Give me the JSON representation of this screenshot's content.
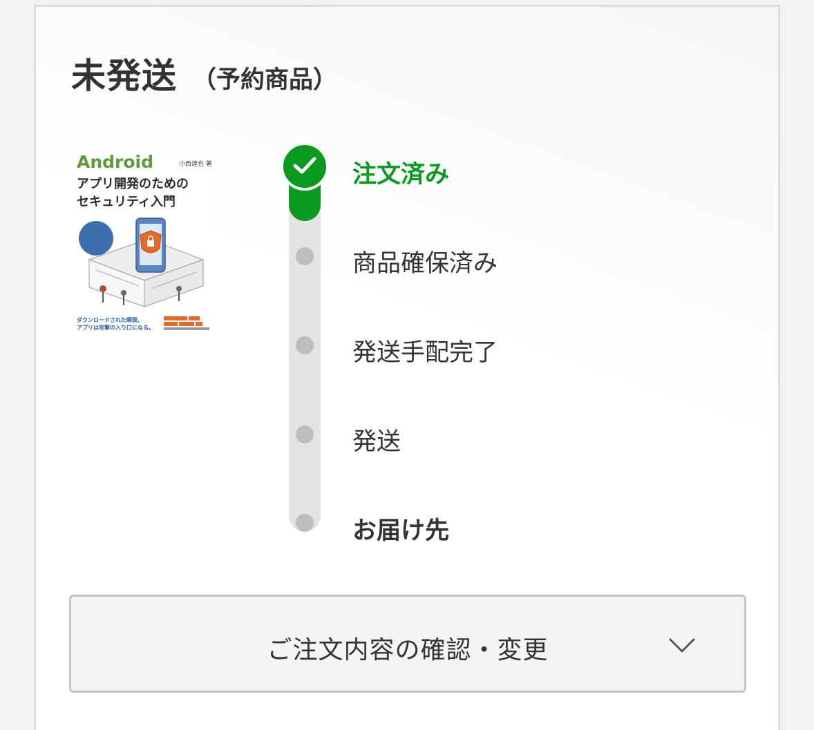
{
  "header": {
    "status": "未発送",
    "status_note": "（予約商品）"
  },
  "product": {
    "cover": {
      "brand": "Android",
      "title_line1": "アプリ開発のための",
      "title_line2": "セキュリティ入門",
      "author": "小西達也 著",
      "tagline": "ダウンロードされた瞬間、\nアプリは攻撃の入り口になる。"
    }
  },
  "progress": {
    "accent_color": "#0a9a1f",
    "inactive_color": "#bdbdbd",
    "current_step": 1,
    "steps": [
      {
        "label": "注文済み",
        "state": "done",
        "icon": "check-icon"
      },
      {
        "label": "商品確保済み",
        "state": "pending"
      },
      {
        "label": "発送手配完了",
        "state": "pending"
      },
      {
        "label": "発送",
        "state": "pending"
      },
      {
        "label": "お届け先",
        "state": "pending"
      }
    ]
  },
  "actions": {
    "details_toggle_label": "ご注文内容の確認・変更",
    "details_toggle_icon": "chevron-down-icon"
  }
}
